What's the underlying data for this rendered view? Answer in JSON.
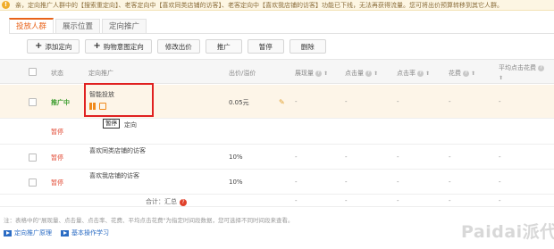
{
  "notice": {
    "text": "亲，定向推广人群中的【搜索重定向】、老客定向中【喜欢同类店铺的访客】、老客定向中【喜欢我店铺的访客】功能已下线，无法再获得流量。您可将出价预算转移到其它人群。"
  },
  "tabs": [
    {
      "label": "投放人群"
    },
    {
      "label": "展示位置"
    },
    {
      "label": "定向推广"
    }
  ],
  "toolbar": {
    "add_targeting": "添加定向",
    "shopping_intent": "购物意图定向",
    "edit_bid": "修改出价",
    "promote": "推广",
    "pause": "暂停",
    "delete": "删除"
  },
  "table": {
    "headers": {
      "status": "状态",
      "targeting": "定向推广",
      "bid": "出价/溢价",
      "impressions": "展现量",
      "clicks": "点击量",
      "ctr": "点击率",
      "cost": "花费",
      "avg_cpc": "平均点击花费"
    },
    "rows": [
      {
        "status": "推广中",
        "targeting": "智能投放",
        "bid": "0.05元",
        "impressions": "-",
        "clicks": "-",
        "ctr": "-",
        "cost": "-",
        "avg_cpc": "-"
      },
      {
        "status": "暂停",
        "targeting": "定向",
        "bid": "",
        "impressions": "-",
        "clicks": "-",
        "ctr": "-",
        "cost": "-",
        "avg_cpc": "-"
      },
      {
        "status": "暂停",
        "targeting": "喜欢同类店铺的访客",
        "bid": "10%",
        "impressions": "-",
        "clicks": "-",
        "ctr": "-",
        "cost": "-",
        "avg_cpc": "-"
      },
      {
        "status": "暂停",
        "targeting": "喜欢我店铺的访客",
        "bid": "10%",
        "impressions": "-",
        "clicks": "-",
        "ctr": "-",
        "cost": "-",
        "avg_cpc": "-"
      }
    ],
    "summary": {
      "label": "合计：汇总",
      "impressions": "-",
      "clicks": "-",
      "ctr": "-",
      "cost": "-",
      "avg_cpc": "-"
    }
  },
  "tooltip": {
    "text": "暂停"
  },
  "footnote": "注：表格中的\"展现量、点击量、点击率、花费、平均点击花费\"为指定时间段数据，您可选择不同时间段来查看。",
  "links": [
    {
      "label": "定向推广原理"
    },
    {
      "label": "基本操作学习"
    }
  ],
  "watermark": "Paidai派代",
  "colors": {
    "accent": "#e8631a",
    "active_status": "#3c9d2f",
    "paused_status": "#e0402a",
    "highlight_box": "#e02020",
    "link": "#2b6cc4"
  },
  "icons": [
    "warning-icon",
    "plus-icon",
    "pause-icon",
    "edit-icon",
    "pencil-icon",
    "help-icon",
    "sort-icon",
    "video-icon"
  ]
}
